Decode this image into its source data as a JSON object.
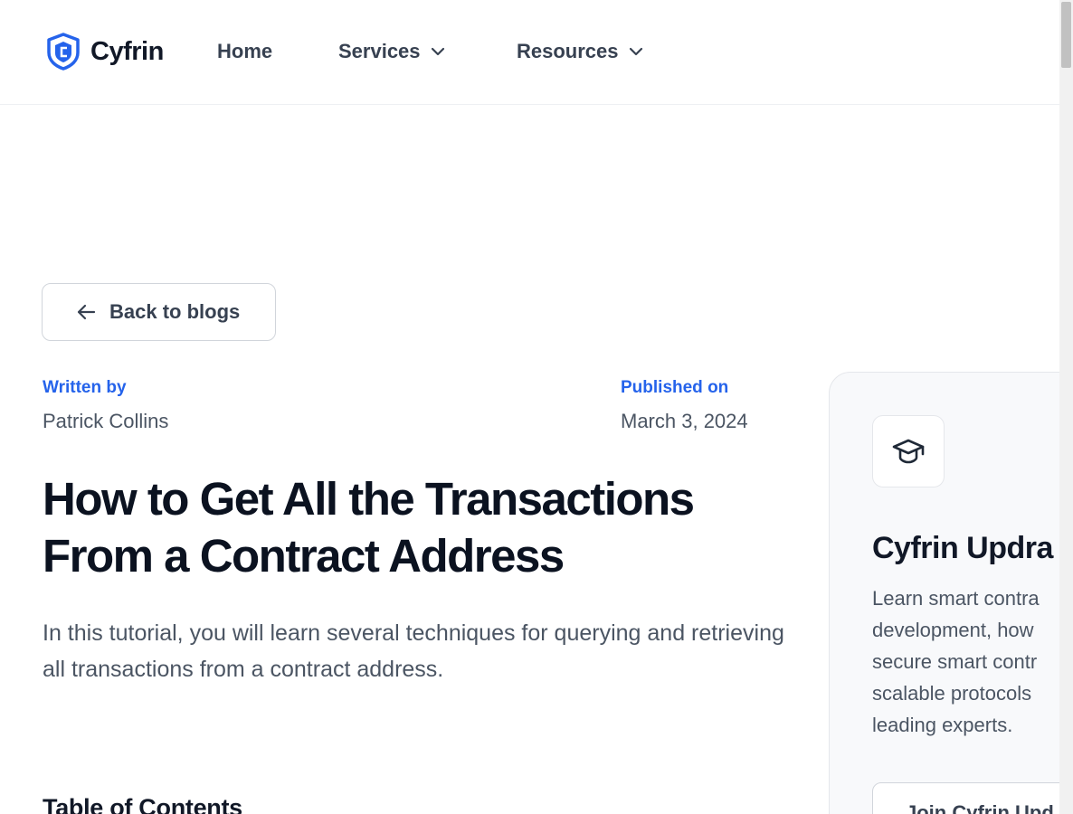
{
  "header": {
    "logo_text": "Cyfrin",
    "brand_color": "#2563eb",
    "nav": {
      "home": "Home",
      "services": "Services",
      "resources": "Resources"
    }
  },
  "back_button": {
    "label": "Back to blogs",
    "icon": "arrow-left-icon"
  },
  "meta": {
    "written_by_label": "Written by",
    "author": "Patrick Collins",
    "published_on_label": "Published on",
    "date": "March 3, 2024"
  },
  "article": {
    "title": "How to Get All the Transactions From a Contract Address",
    "lede": "In this tutorial, you will learn several techniques for querying and retrieving all transactions from a contract address.",
    "toc_heading": "Table of Contents"
  },
  "sidebar_card": {
    "icon": "graduation-cap-icon",
    "title": "Cyfrin Updra",
    "description": "Learn smart contra\ndevelopment, how \nsecure smart contr\nscalable protocols \nleading experts.",
    "button_label": "Join Cyfrin Upd"
  }
}
